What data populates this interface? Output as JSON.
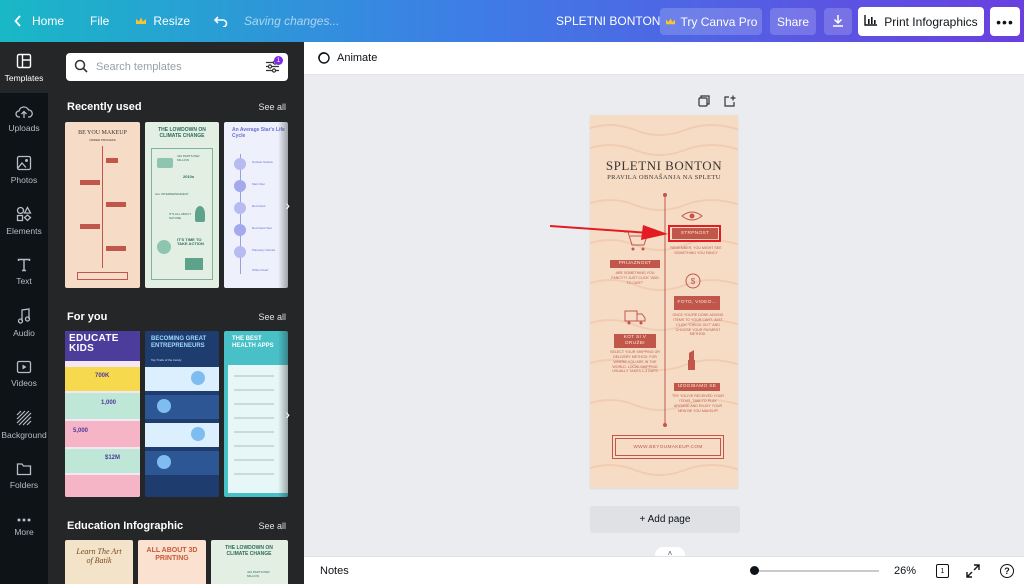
{
  "topbar": {
    "home": "Home",
    "file": "File",
    "resize": "Resize",
    "status": "Saving changes...",
    "doc_title": "SPLETNI BONTON",
    "try_pro": "Try Canva Pro",
    "share": "Share",
    "print": "Print Infographics",
    "more": "•••"
  },
  "rail": [
    {
      "label": "Templates",
      "icon": "templates-icon"
    },
    {
      "label": "Uploads",
      "icon": "upload-icon"
    },
    {
      "label": "Photos",
      "icon": "photos-icon"
    },
    {
      "label": "Elements",
      "icon": "elements-icon"
    },
    {
      "label": "Text",
      "icon": "text-icon"
    },
    {
      "label": "Audio",
      "icon": "audio-icon"
    },
    {
      "label": "Videos",
      "icon": "videos-icon"
    },
    {
      "label": "Background",
      "icon": "background-icon"
    },
    {
      "label": "Folders",
      "icon": "folder-icon"
    },
    {
      "label": "More",
      "icon": "more-icon"
    }
  ],
  "panel": {
    "search_placeholder": "Search templates",
    "filter_badge": "1",
    "sections": [
      {
        "title": "Recently used",
        "see_all": "See all"
      },
      {
        "title": "For you",
        "see_all": "See all"
      },
      {
        "title": "Education Infographic",
        "see_all": "See all"
      }
    ],
    "recent": [
      {
        "title": "BE YOU MAKEUP",
        "sub": "ORDER PROCESS"
      },
      {
        "title": "THE LOWDOWN ON CLIMATE CHANGE",
        "rows": [
          "416 PARTS PER MILLION",
          "2010s",
          "ALL INTERDEPENDENT",
          "IT'S ALL ABOUT NATURE",
          "IT'S TIME TO TAKE ACTION"
        ]
      },
      {
        "title": "An Average Star's Life Cycle",
        "rows": [
          "Nuclear Nebula",
          "Main Star",
          "Red Giant",
          "Red Giant Star",
          "Planetary Nebula",
          "White Dwarf"
        ]
      }
    ],
    "for_you": [
      {
        "title": "EDUCATE KIDS",
        "stats": [
          "700K",
          "1,000",
          "5,000",
          "$12M"
        ]
      },
      {
        "title": "BECOMING GREAT ENTREPRENEURS",
        "sub": "Top Traits of the trendy"
      },
      {
        "title": "THE BEST HEALTH APPS"
      }
    ],
    "education": [
      {
        "title": "Learn The Art of Batik"
      },
      {
        "title": "ALL ABOUT 3D PRINTING"
      },
      {
        "title": "THE LOWDOWN ON CLIMATE CHANGE",
        "rows": [
          "416 PARTS PER MILLION"
        ]
      }
    ]
  },
  "editor": {
    "animate": "Animate",
    "add_page": "+ Add page",
    "notes": "Notes",
    "zoom": "26%",
    "page_count": "1",
    "help": "?"
  },
  "design": {
    "title": "SPLETNI BONTON",
    "subtitle": "PRAVILA OBNAŠANJA NA SPLETU",
    "step1_tag": "STRPNOST",
    "step1_text": "REMEMBER, YOU MIGHT SEE SOMETHING YOU FANCY",
    "step2_tag": "PRIJAZNOST",
    "step2_text": "ARE SOMETHING YOU FANCY?? JUST CLICK \"ADD TO CART\"",
    "step3_tag": "FOTO, VIDEO...",
    "step3_text": "ONCE YOU'RE DONE ADDING ITEMS TO YOUR CART, JUST CLICK \"CHECK OUT\" AND CHOOSE YOUR PAYMENT METHOD.",
    "step4_tag": "KOT SI V DRUŽBI",
    "step4_text": "SELECT YOUR SHIPPING OR DELIVERY METHOD. FOR WHERE YOU ARE IN THE WORLD. LOCAL SHIPPING USUALLY TAKES 1-3 DAYS",
    "step5_tag": "IZOGIBAMO SE",
    "step5_text": "TRY YOU'VE RECEIVED YOUR ITEMS, TIME TO PLAY AROUND AND ENJOY YOUR NEW BE YOU MAKEUP!",
    "footer": "WWW.BEYOUMAKEUP.COM"
  },
  "colors": {
    "page_bg": "#f7dcc5",
    "accent": "#c0574a",
    "annotation": "#e31b23"
  }
}
